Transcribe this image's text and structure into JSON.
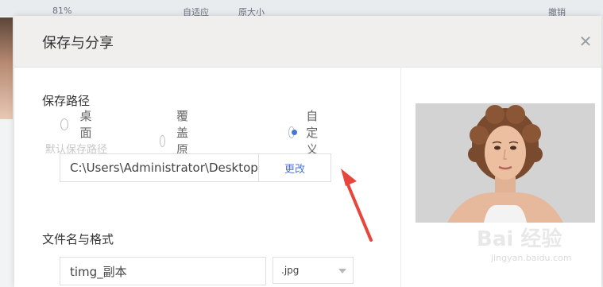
{
  "background": {
    "zoom_label": "81%",
    "fit_label": "自适应",
    "original_size_label": "原大小",
    "undo_label": "撤销"
  },
  "dialog": {
    "title": "保存与分享",
    "save_path": {
      "section_title": "保存路径",
      "options": [
        {
          "label": "桌面",
          "checked": false
        },
        {
          "label": "覆盖原图",
          "checked": false
        },
        {
          "label": "自定义",
          "checked": true
        }
      ],
      "caption": "默认保存路径",
      "path_value": "C:\\Users\\Administrator\\Desktop",
      "change_label": "更改"
    },
    "filename": {
      "section_title": "文件名与格式",
      "name_value": "timg_副本",
      "format_value": ".jpg"
    }
  },
  "watermark": {
    "brand": "Bai 经验",
    "url": "jingyan.baidu.com"
  },
  "colors": {
    "accent": "#4a74d8",
    "annotation_arrow": "#e8453c"
  }
}
